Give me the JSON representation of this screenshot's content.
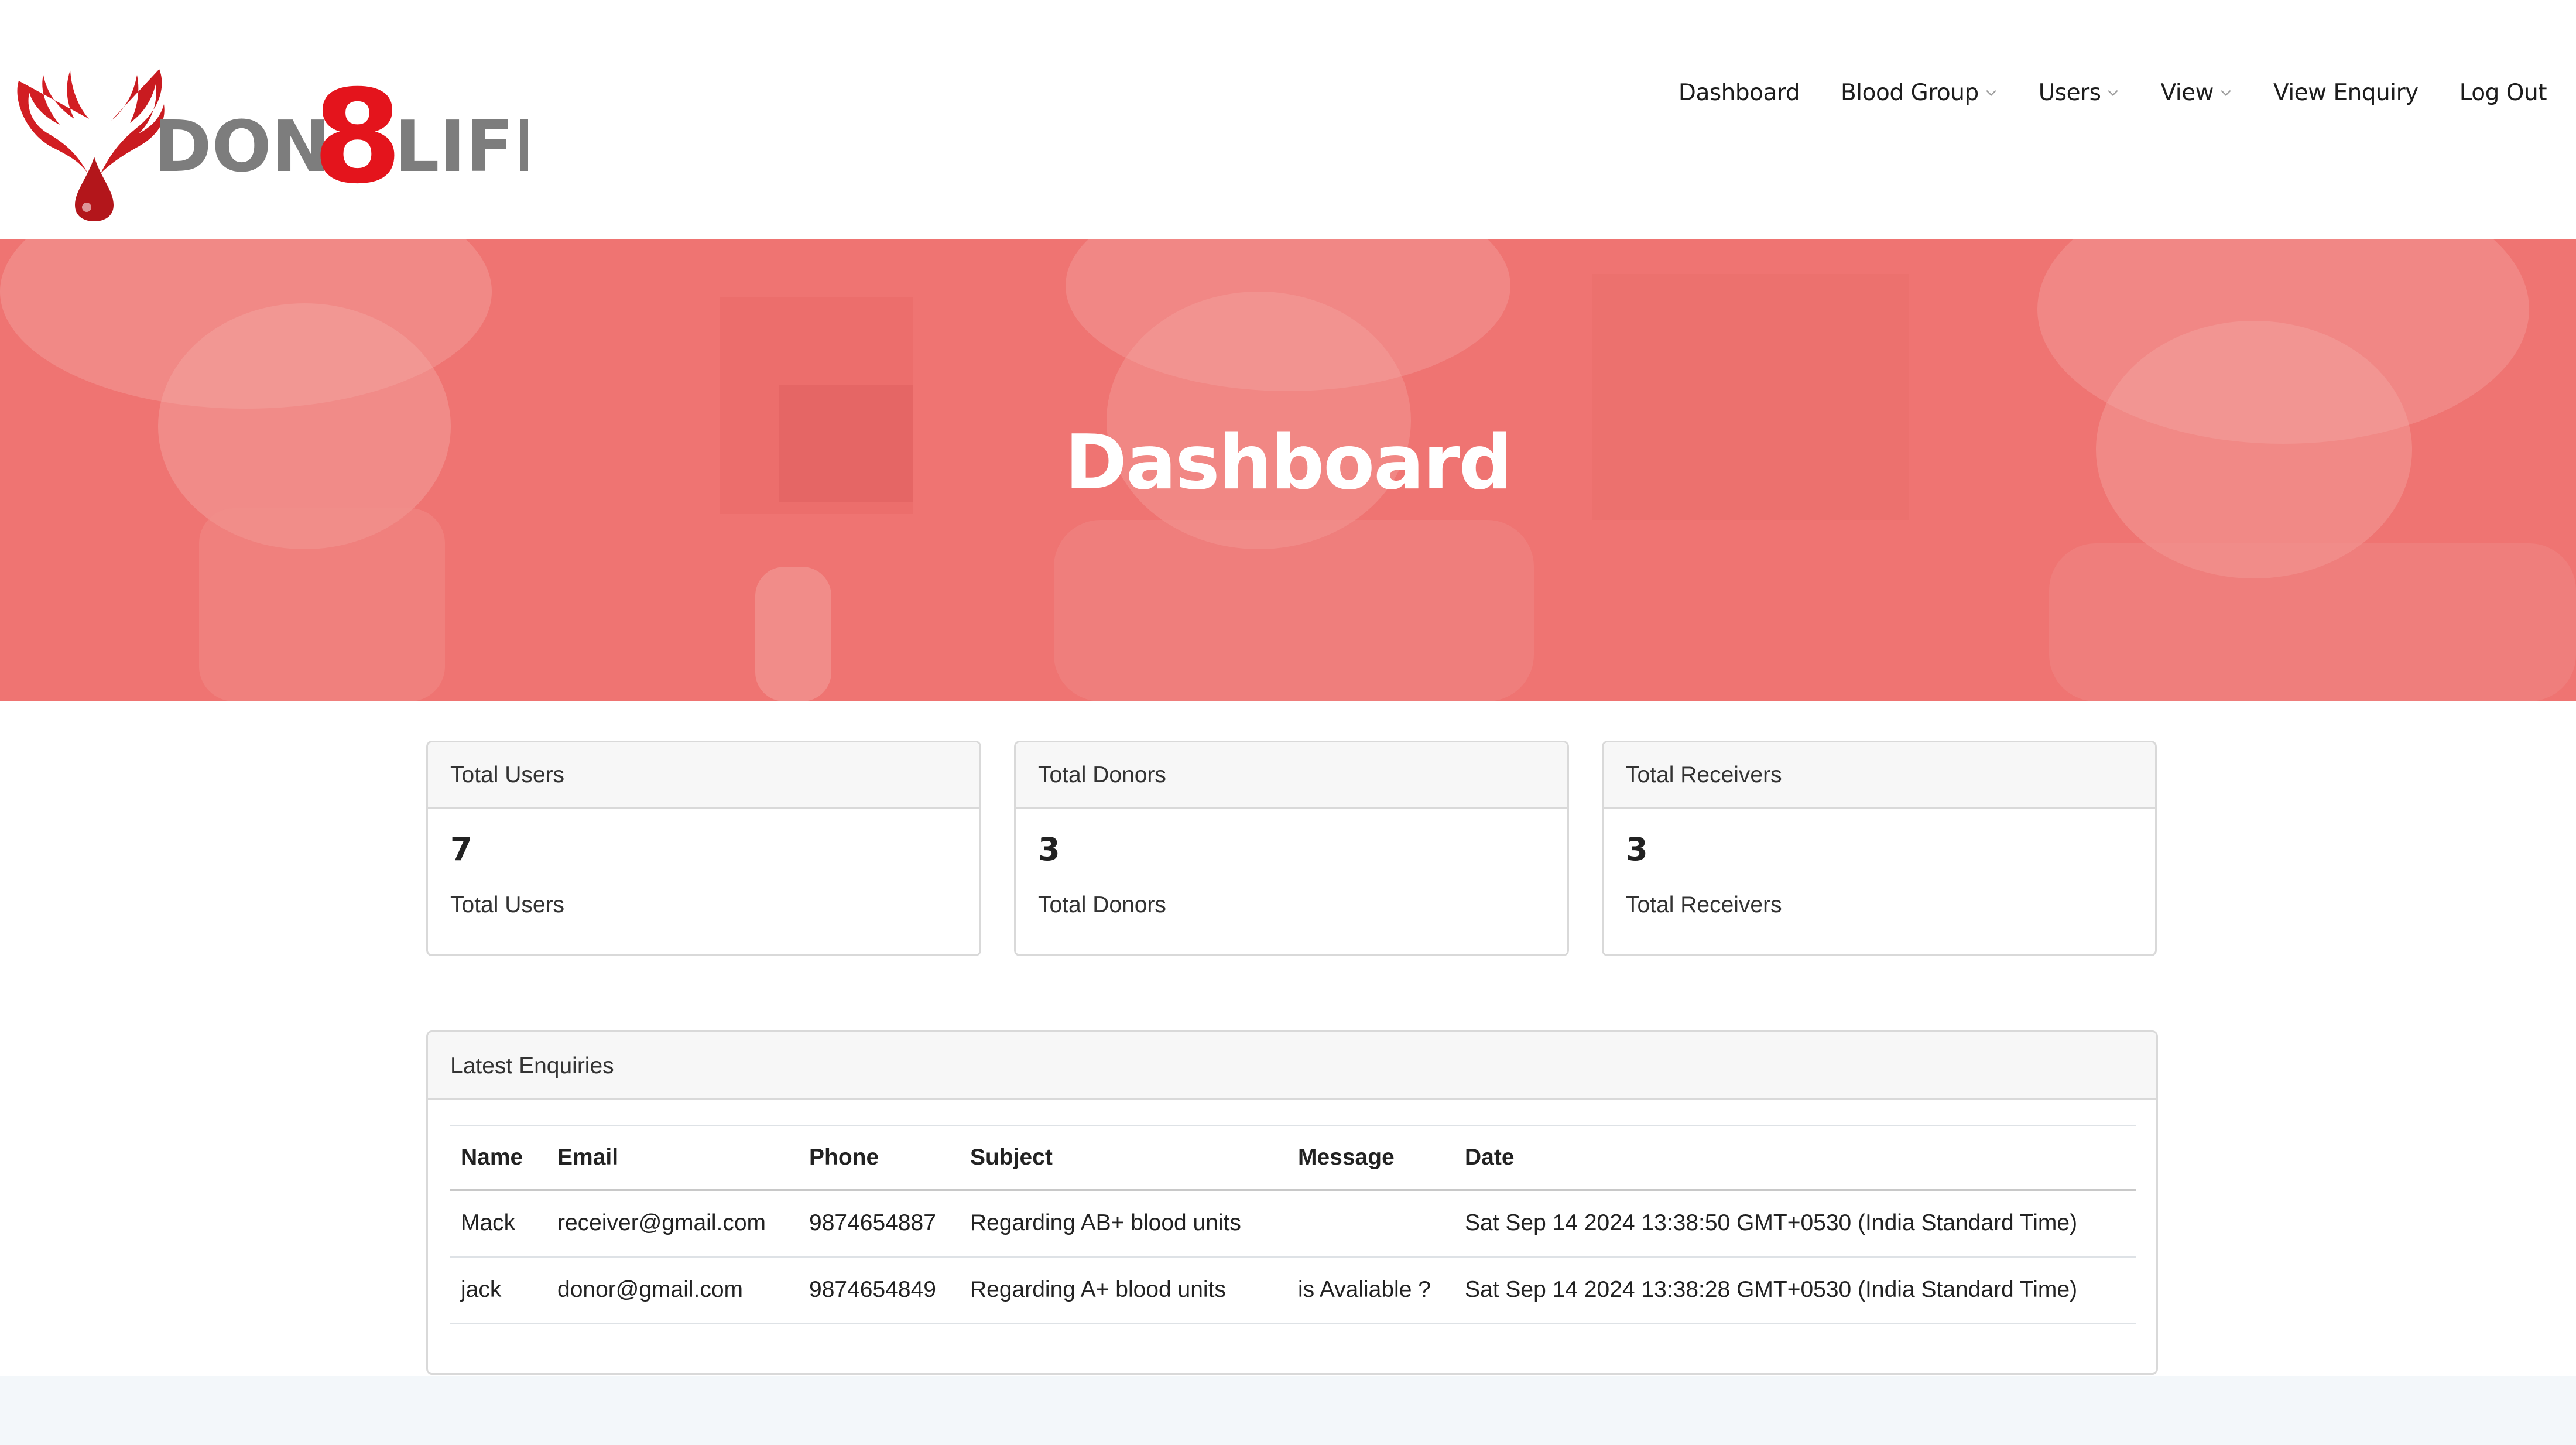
{
  "brand": {
    "logo_text_left": "DON",
    "logo_text_num": "8",
    "logo_text_right": "LIFE",
    "accent": "#e4141c"
  },
  "nav": {
    "items": [
      {
        "label": "Dashboard",
        "dropdown": false
      },
      {
        "label": "Blood Group",
        "dropdown": true
      },
      {
        "label": "Users",
        "dropdown": true
      },
      {
        "label": "View",
        "dropdown": true
      },
      {
        "label": "View Enquiry",
        "dropdown": false
      },
      {
        "label": "Log Out",
        "dropdown": false
      }
    ]
  },
  "hero": {
    "title": "Dashboard",
    "overlay_color": "#ef7472"
  },
  "stats": [
    {
      "header": "Total Users",
      "value": "7",
      "label": "Total Users"
    },
    {
      "header": "Total Donors",
      "value": "3",
      "label": "Total Donors"
    },
    {
      "header": "Total Receivers",
      "value": "3",
      "label": "Total Receivers"
    }
  ],
  "enquiries": {
    "header": "Latest Enquiries",
    "columns": [
      "Name",
      "Email",
      "Phone",
      "Subject",
      "Message",
      "Date"
    ],
    "rows": [
      {
        "name": "Mack",
        "email": "receiver@gmail.com",
        "phone": "9874654887",
        "subject": "Regarding AB+ blood units",
        "message": "",
        "date": "Sat Sep 14 2024 13:38:50 GMT+0530 (India Standard Time)"
      },
      {
        "name": "jack",
        "email": "donor@gmail.com",
        "phone": "9874654849",
        "subject": "Regarding A+ blood units",
        "message": "is Avaliable ?",
        "date": "Sat Sep 14 2024 13:38:28 GMT+0530 (India Standard Time)"
      }
    ]
  }
}
